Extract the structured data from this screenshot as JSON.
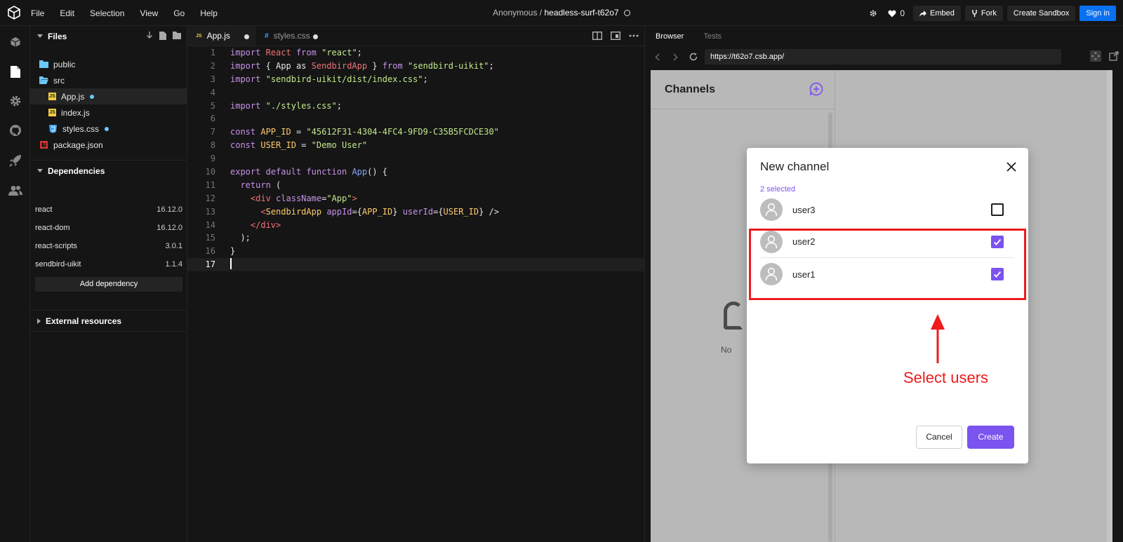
{
  "menu": [
    "File",
    "Edit",
    "Selection",
    "View",
    "Go",
    "Help"
  ],
  "title": {
    "owner": "Anonymous /",
    "sandbox": "headless-surf-t62o7"
  },
  "topbar": {
    "likes": "0",
    "embed": "Embed",
    "fork": "Fork",
    "create_sandbox": "Create Sandbox",
    "sign_in": "Sign in"
  },
  "sidebar": {
    "files_header": "Files",
    "files": [
      {
        "name": "public",
        "type": "folder"
      },
      {
        "name": "src",
        "type": "folder-open"
      },
      {
        "name": "App.js",
        "type": "js",
        "modified": true,
        "active": true
      },
      {
        "name": "index.js",
        "type": "js"
      },
      {
        "name": "styles.css",
        "type": "css",
        "modified": true
      },
      {
        "name": "package.json",
        "type": "npm"
      }
    ],
    "deps_header": "Dependencies",
    "dependencies": [
      {
        "name": "react",
        "version": "16.12.0"
      },
      {
        "name": "react-dom",
        "version": "16.12.0"
      },
      {
        "name": "react-scripts",
        "version": "3.0.1"
      },
      {
        "name": "sendbird-uikit",
        "version": "1.1.4"
      }
    ],
    "add_dependency": "Add dependency",
    "external_header": "External resources"
  },
  "editor": {
    "tabs": [
      {
        "label": "App.js",
        "lang": "JS",
        "active": true
      },
      {
        "label": "styles.css",
        "lang": "#",
        "active": false
      }
    ],
    "line_numbers": [
      "1",
      "2",
      "3",
      "4",
      "5",
      "6",
      "7",
      "8",
      "9",
      "10",
      "11",
      "12",
      "13",
      "14",
      "15",
      "16",
      "17"
    ],
    "code": {
      "l1a": "import",
      "l1b": "React",
      "l1c": "from",
      "l1d": "\"react\"",
      "l1e": ";",
      "l2a": "import",
      "l2b": "{ App as ",
      "l2c": "SendbirdApp",
      "l2d": " } ",
      "l2e": "from",
      "l2f": "\"sendbird-uikit\"",
      "l2g": ";",
      "l3a": "import",
      "l3b": "\"sendbird-uikit/dist/index.css\"",
      "l3c": ";",
      "l5a": "import",
      "l5b": "\"./styles.css\"",
      "l5c": ";",
      "l7a": "const",
      "l7b": "APP_ID",
      "l7c": " = ",
      "l7d": "\"45612F31-4304-4FC4-9FD9-C35B5FCDCE30\"",
      "l8a": "const",
      "l8b": "USER_ID",
      "l8c": " = ",
      "l8d": "\"Demo User\"",
      "l10a": "export",
      "l10b": "default",
      "l10c": "function",
      "l10d": "App",
      "l10e": "() {",
      "l11a": "return",
      "l11b": " (",
      "l12a": "<div",
      "l12b": "className",
      "l12c": "=",
      "l12d": "\"App\"",
      "l12e": ">",
      "l13a": "<",
      "l13b": "SendbirdApp",
      "l13c": "appId",
      "l13d": "={",
      "l13e": "APP_ID",
      "l13f": "} ",
      "l13g": "userId",
      "l13h": "={",
      "l13i": "USER_ID",
      "l13j": "} />",
      "l14a": "</div>",
      "l15a": ");",
      "l16a": "}"
    }
  },
  "preview": {
    "tabs": [
      "Browser",
      "Tests"
    ],
    "url": "https://t62o7.csb.app/",
    "channels_title": "Channels",
    "empty_text": "No",
    "modal": {
      "title": "New channel",
      "selected": "2 selected",
      "users": [
        {
          "name": "user3",
          "checked": false
        },
        {
          "name": "user2",
          "checked": true
        },
        {
          "name": "user1",
          "checked": true
        }
      ],
      "cancel": "Cancel",
      "create": "Create"
    },
    "accent": "#7b53ef"
  },
  "annotation": {
    "text": "Select users",
    "color": "#ee1c1c"
  }
}
